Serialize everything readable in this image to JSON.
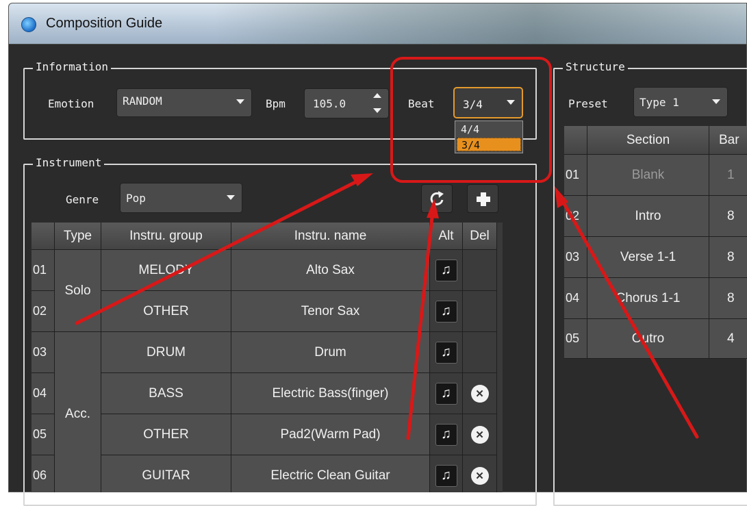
{
  "window": {
    "title": "Composition Guide",
    "icon": "app-logo-icon"
  },
  "information": {
    "group_title": "Information",
    "emotion_label": "Emotion",
    "emotion_value": "RANDOM",
    "bpm_label": "Bpm",
    "bpm_value": "105.0",
    "beat_label": "Beat",
    "beat_value": "3/4",
    "beat_options": [
      "4/4",
      "3/4"
    ]
  },
  "structure": {
    "group_title": "Structure",
    "preset_label": "Preset",
    "preset_value": "Type 1",
    "headers": [
      "Section",
      "Bar"
    ],
    "rows": [
      {
        "no": "01",
        "section": "Blank",
        "bars": "1"
      },
      {
        "no": "02",
        "section": "Intro",
        "bars": "8"
      },
      {
        "no": "03",
        "section": "Verse 1-1",
        "bars": "8"
      },
      {
        "no": "04",
        "section": "Chorus 1-1",
        "bars": "8"
      },
      {
        "no": "05",
        "section": "Outro",
        "bars": "4"
      }
    ]
  },
  "instrument": {
    "group_title": "Instrument",
    "genre_label": "Genre",
    "genre_value": "Pop",
    "headers": [
      "Type",
      "Instru. group",
      "Instru. name",
      "Alt",
      "Del"
    ],
    "type_groups": [
      "Solo",
      "Acc."
    ],
    "rows": [
      {
        "no": "01",
        "group": "MELODY",
        "name": "Alto Sax"
      },
      {
        "no": "02",
        "group": "OTHER",
        "name": "Tenor Sax"
      },
      {
        "no": "03",
        "group": "DRUM",
        "name": "Drum"
      },
      {
        "no": "04",
        "group": "BASS",
        "name": "Electric Bass(finger)"
      },
      {
        "no": "05",
        "group": "OTHER",
        "name": "Pad2(Warm Pad)"
      },
      {
        "no": "06",
        "group": "GUITAR",
        "name": "Electric Clean Guitar"
      }
    ]
  },
  "icons": {
    "refresh": "refresh-icon",
    "add": "plus-icon",
    "alt": "music-note-icon",
    "delete": "close-circle-icon"
  },
  "colors": {
    "accent": "#e8901e",
    "annotation": "#d81818"
  }
}
